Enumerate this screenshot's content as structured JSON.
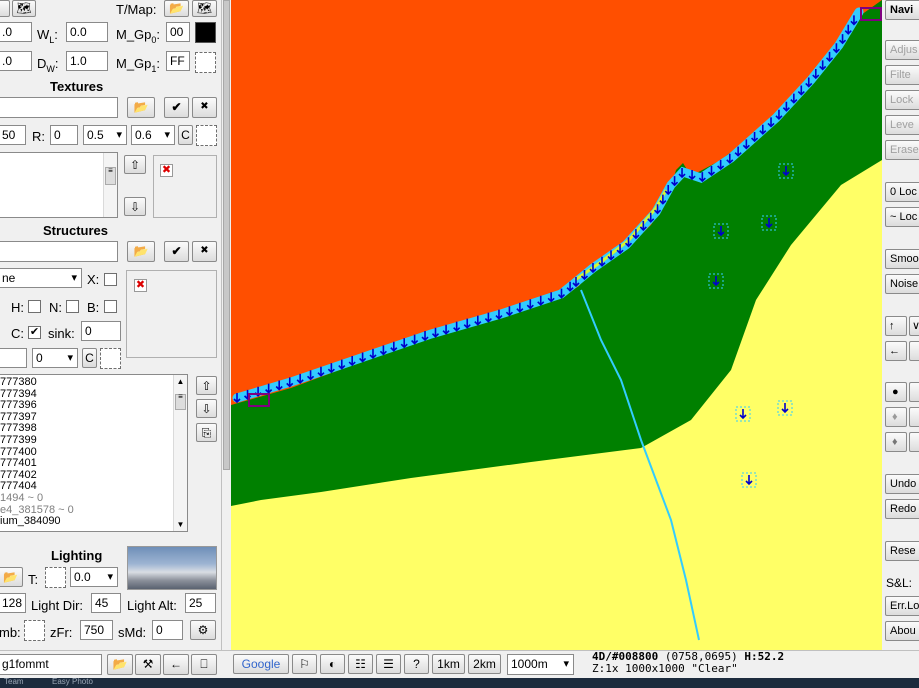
{
  "left_panel": {
    "wl_label": "W",
    "wl_sub": "L",
    "wl_value": "0.0",
    "row1_left_value": ".0",
    "dw_label": "D",
    "dw_sub": "W",
    "dw_value": "1.0",
    "row2_left_value": ".0",
    "tmap_label": "T/Map:",
    "mgp0_label": "M_Gp",
    "mgp0_sub": "0",
    "mgp0_value": "00",
    "mgp1_label": "M_Gp",
    "mgp1_sub": "1",
    "mgp1_value": "FF",
    "textures": {
      "title": "Textures",
      "row_value": "50",
      "r_label": "R:",
      "r_value": "0",
      "sel1": "0.5",
      "sel2": "0.6",
      "c_button": "C"
    },
    "structures": {
      "title": "Structures",
      "type_select": "ne",
      "x_label": "X:",
      "h_label": "H:",
      "n_label": "N:",
      "b_label": "B:",
      "c_label": "C:",
      "sink_label": "sink:",
      "sink_value": "0",
      "sel_value": "0",
      "c_button": "C",
      "list": [
        {
          "text": "777380",
          "gray": false
        },
        {
          "text": "777394",
          "gray": false
        },
        {
          "text": "777396",
          "gray": false
        },
        {
          "text": "777397",
          "gray": false
        },
        {
          "text": "777398",
          "gray": false
        },
        {
          "text": "777399",
          "gray": false
        },
        {
          "text": "777400",
          "gray": false
        },
        {
          "text": "777401",
          "gray": false
        },
        {
          "text": "777402",
          "gray": false
        },
        {
          "text": "777404",
          "gray": false
        },
        {
          "text": "1494 ~ 0",
          "gray": true
        },
        {
          "text": "e4_381578 ~ 0",
          "gray": true
        },
        {
          "text": "ium_384090",
          "gray": false
        }
      ]
    },
    "lighting": {
      "title": "Lighting",
      "t_label": "T:",
      "t_value": "0.0",
      "val128": "128",
      "dir_label": "Light Dir:",
      "dir_value": "45",
      "alt_label": "Light Alt:",
      "alt_value": "25",
      "amb_label": "mb:",
      "zfr_label": "zFr:",
      "zfr_value": "750",
      "smd_label": "sMd:",
      "smd_value": "0"
    }
  },
  "right_bar": {
    "items": [
      "Navi",
      "Adjus",
      "Filte",
      "Lock",
      "Leve",
      "Erase",
      "0 Loc",
      "~ Loc",
      "Smoo",
      "Noise",
      "Undo",
      "Redo",
      "Rese",
      "Err.Lo",
      "Abou"
    ],
    "sl_label": "S&L:"
  },
  "bottom_bar": {
    "file_field": "g1fommt",
    "google_label": "Google",
    "help_label": "?",
    "km1_label": "1km",
    "km2_label": "2km",
    "scale_select": "1000m",
    "status_line1_a": "4D/#008800",
    "status_line1_b": "(0758,0695)",
    "status_line1_c": "H:52.2",
    "status_line2": "Z:1x 1000x1000 \"Clear\""
  },
  "taskbar": {
    "item1": "Team",
    "item2": "Easy Photo"
  },
  "map": {
    "colors": {
      "upper": "#ff4f00",
      "middle": "#008000",
      "lower": "#ffff66",
      "road": "#33ccff",
      "marker": "#0000cc"
    }
  }
}
